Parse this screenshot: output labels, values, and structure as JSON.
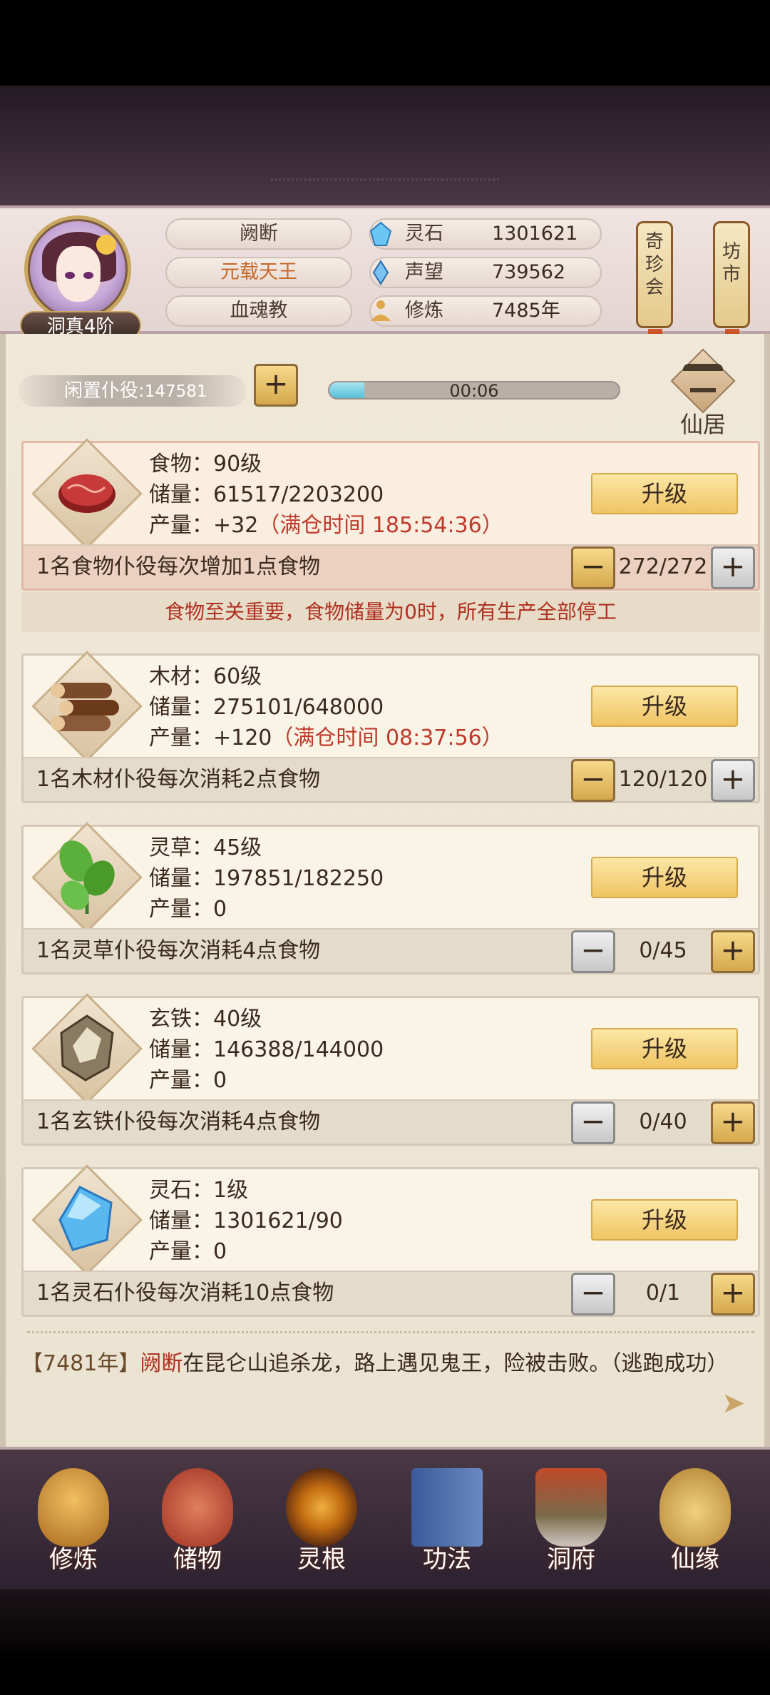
{
  "header": {
    "rank": "洞真4阶",
    "tags": [
      "阙断",
      "元载天王",
      "血魂教"
    ],
    "resources": [
      {
        "name": "灵石",
        "value": "1301621",
        "icon": "spirit-stone-icon"
      },
      {
        "name": "声望",
        "value": "739562",
        "icon": "prestige-icon"
      },
      {
        "name": "修炼",
        "value": "7485年",
        "icon": "meditation-icon"
      }
    ],
    "lantern_left": "奇珍会",
    "lantern_right": "坊市"
  },
  "workers": {
    "idle_label": "闲置仆役:",
    "idle_count": "147581",
    "timer_text": "00:06",
    "timer_progress": 0.12,
    "xianju_label": "仙居"
  },
  "notice": "食物至关重要，食物储量为0时，所有生产全部停工",
  "upgrade_label": "升级",
  "plus_label": "+",
  "minus_label": "−",
  "cards": [
    {
      "name": "食物：90级",
      "storage": "储量：61517/2203200",
      "output": "产量：+32",
      "full_time": "（满仓时间 185:54:36）",
      "desc": "1名食物仆役每次增加1点食物",
      "count": "272/272",
      "icon": "meat-icon"
    },
    {
      "name": "木材：60级",
      "storage": "储量：275101/648000",
      "output": "产量：+120",
      "full_time": "（满仓时间 08:37:56）",
      "desc": "1名木材仆役每次消耗2点食物",
      "count": "120/120",
      "icon": "wood-icon"
    },
    {
      "name": "灵草：45级",
      "storage": "储量：197851/182250",
      "output": "产量：0",
      "full_time": "",
      "desc": "1名灵草仆役每次消耗4点食物",
      "count": "0/45",
      "icon": "herb-icon"
    },
    {
      "name": "玄铁：40级",
      "storage": "储量：146388/144000",
      "output": "产量：0",
      "full_time": "",
      "desc": "1名玄铁仆役每次消耗4点食物",
      "count": "0/40",
      "icon": "iron-ore-icon"
    },
    {
      "name": "灵石：1级",
      "storage": "储量：1301621/90",
      "output": "产量：0",
      "full_time": "",
      "desc": "1名灵石仆役每次消耗10点食物",
      "count": "0/1",
      "icon": "crystal-icon"
    }
  ],
  "log": {
    "year": "【7481年】",
    "name": "阙断",
    "text": "在昆仑山追杀龙，路上遇见鬼王，险被击败。（逃跑成功）"
  },
  "nav": [
    "修炼",
    "储物",
    "灵根",
    "功法",
    "洞府",
    "仙缘"
  ]
}
